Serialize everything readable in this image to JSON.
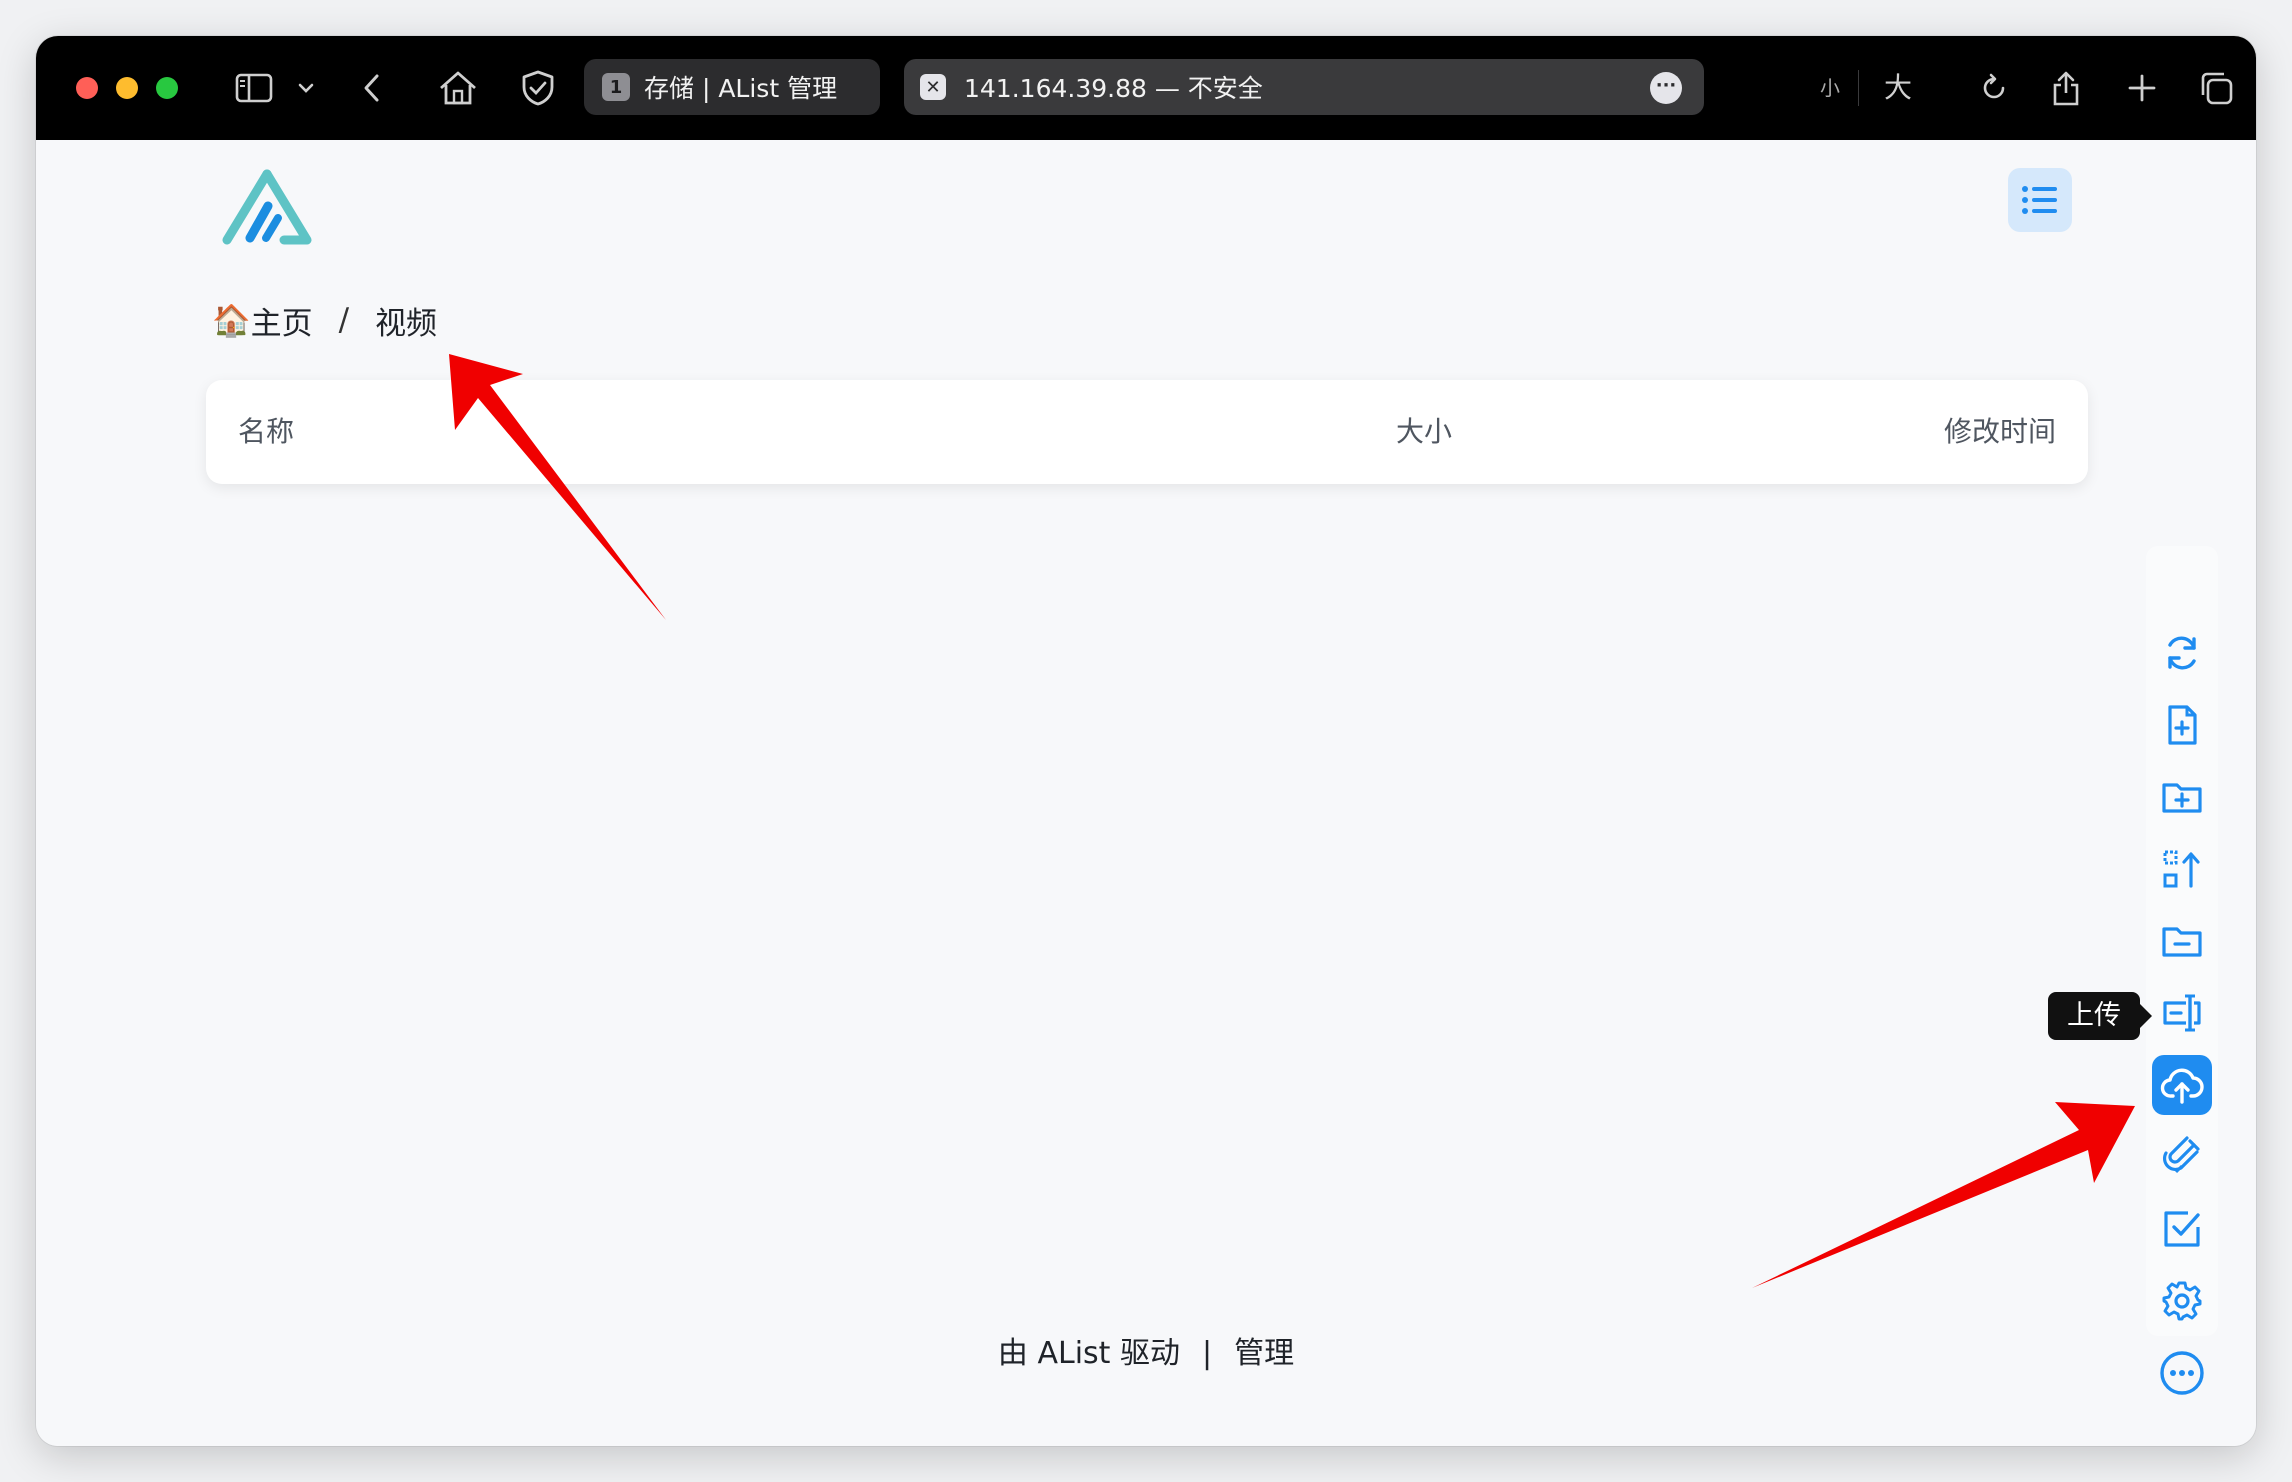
{
  "browser": {
    "tabs": [
      {
        "badge": "1",
        "title": "存储 | AList 管理"
      },
      {
        "title": "141.164.39.88 — 不安全"
      }
    ],
    "zoom_small": "小",
    "zoom_big": "大"
  },
  "breadcrumb": {
    "home_emoji": "🏠",
    "home": "主页",
    "separator": "/",
    "current": "视频"
  },
  "table": {
    "columns": [
      "名称",
      "大小",
      "修改时间"
    ]
  },
  "footer": {
    "powered": "由 AList 驱动",
    "separator": "|",
    "manage": "管理"
  },
  "sidebar": {
    "tooltip": "上传",
    "actions": [
      "refresh",
      "new-file",
      "new-folder",
      "recursive-move",
      "remove-empty-directory",
      "batch-rename",
      "upload",
      "offline-download",
      "multi-select",
      "local-settings",
      "more"
    ]
  },
  "colors": {
    "accent": "#1f8cf0",
    "annotation_arrow": "#f00000",
    "logo_teal": "#5ec3c5",
    "logo_blue": "#1b8de0"
  }
}
